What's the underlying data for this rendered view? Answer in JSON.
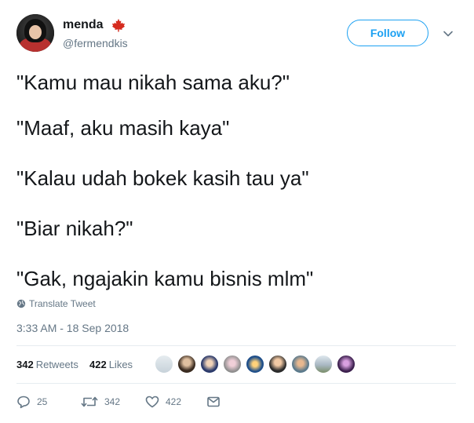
{
  "user": {
    "name": "menda",
    "handle": "@fermendkis",
    "flag_icon": "canada-flag-icon"
  },
  "follow_button": {
    "label": "Follow"
  },
  "tweet": {
    "lines": [
      "\"Kamu mau nikah sama aku?\"",
      "\"Maaf, aku masih kaya\"",
      "\"Kalau udah bokek kasih tau ya\"",
      "\"Biar nikah?\"",
      "\"Gak, ngajakin kamu bisnis mlm\""
    ]
  },
  "translate": {
    "label": "Translate Tweet",
    "icon": "globe-icon"
  },
  "timestamp": "3:33 AM - 18 Sep 2018",
  "stats": {
    "retweets_count": "342",
    "retweets_label": "Retweets",
    "likes_count": "422",
    "likes_label": "Likes"
  },
  "actions": {
    "reply_count": "25",
    "retweet_count": "342",
    "like_count": "422"
  },
  "colors": {
    "accent": "#1da1f2",
    "text": "#14171a",
    "muted": "#657786",
    "flag_red": "#d52b1e"
  }
}
